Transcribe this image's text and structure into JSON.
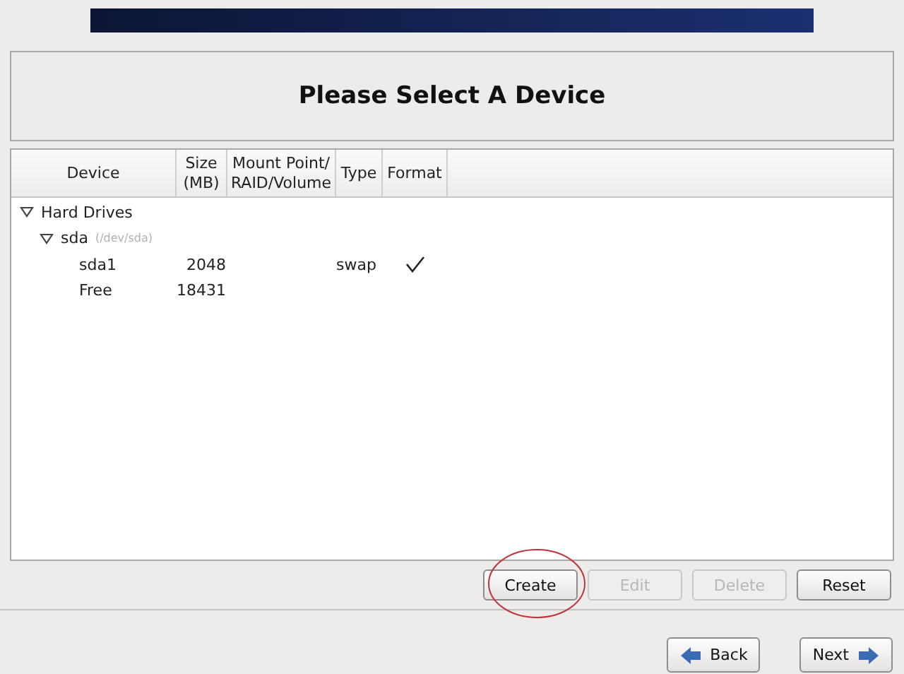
{
  "title": "Please Select A Device",
  "table": {
    "columns": [
      {
        "label": "Device"
      },
      {
        "label": "Size\n(MB)"
      },
      {
        "label": "Mount Point/\nRAID/Volume"
      },
      {
        "label": "Type"
      },
      {
        "label": "Format"
      }
    ],
    "tree": [
      {
        "name": "Hard Drives",
        "expanded": true,
        "children": [
          {
            "name": "sda",
            "path": "(/dev/sda)",
            "expanded": true,
            "children": [
              {
                "name": "sda1",
                "size": "2048",
                "type": "swap",
                "format": true
              },
              {
                "name": "Free",
                "size": "18431",
                "format": false
              }
            ]
          }
        ]
      }
    ]
  },
  "actions": [
    {
      "label": "Create",
      "disabled": false
    },
    {
      "label": "Edit",
      "disabled": true
    },
    {
      "label": "Delete",
      "disabled": true
    },
    {
      "label": "Reset",
      "disabled": false
    }
  ],
  "nav": [
    {
      "label": "Back",
      "kind": "back"
    },
    {
      "label": "Next",
      "kind": "next"
    }
  ]
}
